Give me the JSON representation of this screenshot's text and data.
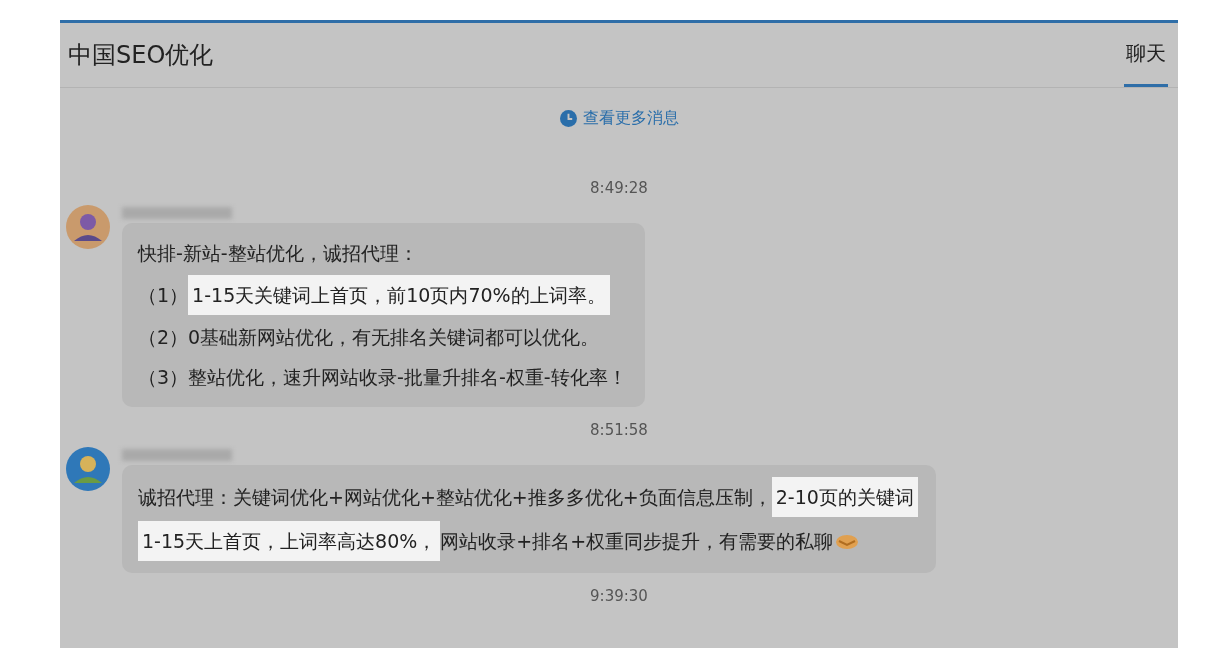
{
  "header": {
    "title": "中国SEO优化",
    "tabs": [
      {
        "label": "聊天",
        "selected": true
      }
    ]
  },
  "load_more": {
    "label": "查看更多消息"
  },
  "timeline": [
    {
      "kind": "time",
      "text": "8:49:28"
    },
    {
      "kind": "message",
      "lines": [
        {
          "segments": [
            {
              "text": "快排-新站-整站优化，诚招代理：",
              "highlighted": false
            }
          ]
        },
        {
          "segments": [
            {
              "text": "（1）",
              "highlighted": false
            },
            {
              "text": "1-15天关键词上首页，前10页内70%的上词率。",
              "highlighted": true
            }
          ]
        },
        {
          "segments": [
            {
              "text": "（2）0基础新网站优化，有无排名关键词都可以优化。",
              "highlighted": false
            }
          ]
        },
        {
          "segments": [
            {
              "text": "（3）整站优化，速升网站收录-批量升排名-权重-转化率！",
              "highlighted": false
            }
          ]
        }
      ]
    },
    {
      "kind": "time",
      "text": "8:51:58"
    },
    {
      "kind": "message",
      "lines": [
        {
          "segments": [
            {
              "text": "诚招代理：关键词优化+网站优化+整站优化+推多多优化+负面信息压制，",
              "highlighted": false
            },
            {
              "text": "2-10页的关键词",
              "highlighted": true
            }
          ]
        },
        {
          "segments": [
            {
              "text": "1-15天上首页，上词率高达80%，",
              "highlighted": true
            },
            {
              "text": "网站收录+排名+权重同步提升，有需要的私聊",
              "highlighted": false
            }
          ],
          "end_icon": true
        }
      ]
    },
    {
      "kind": "time",
      "text": "9:39:30"
    }
  ]
}
